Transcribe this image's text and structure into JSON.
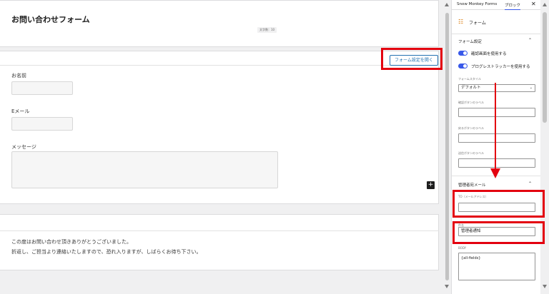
{
  "canvas": {
    "title": "お問い合わせフォーム",
    "char_count": "文字数：10",
    "form_settings_button": "フォーム設定を開く",
    "fields": [
      {
        "label": "お名前"
      },
      {
        "label": "Eメール"
      },
      {
        "label": "メッセージ"
      }
    ],
    "add_block": "+",
    "completion_lines": [
      "この度はお問い合わせ頂きありがとうございました。",
      "折返し、ご担当より連絡いたしますので、恐れ入りますが、しばらくお待ち下さい。"
    ]
  },
  "sidebar": {
    "tabs": [
      "Snow Monkey Forms",
      "ブロック"
    ],
    "close": "✕",
    "block_name": "フォーム",
    "form_settings": {
      "title": "フォーム設定",
      "toggles": [
        "確認画面を使用する",
        "プログレストラッカーを使用する"
      ],
      "style_label": "フォームスタイル",
      "style_value": "デフォルト",
      "confirm_label": "確認ボタンのラベル",
      "back_label": "戻るボタンのラベル",
      "send_label": "送信ボタンのラベル"
    },
    "admin_mail": {
      "title": "管理者宛メール",
      "to_label": "TO（メールアドレス）",
      "subject_label": "件名",
      "subject_value": "管理者通知",
      "body_label": "BODY",
      "body_value": "{all-fields}"
    }
  },
  "colors": {
    "highlight": "#e3000f",
    "accent": "#3858e9",
    "link": "#2271b1"
  }
}
